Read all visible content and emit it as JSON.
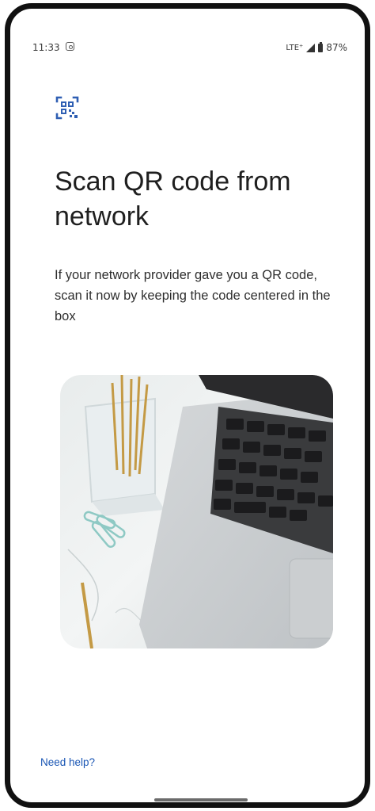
{
  "status_bar": {
    "time": "11:33",
    "network": "LTE⁺",
    "battery": "87%"
  },
  "icons": {
    "header": "qr-code-scan-icon",
    "status": [
      "camera-notification-icon",
      "signal-icon",
      "battery-icon"
    ]
  },
  "page": {
    "title": "Scan QR code from network",
    "description": "If your network provider gave you a QR code, scan it now by keeping the code centered in the box"
  },
  "footer": {
    "help_link": "Need help?"
  },
  "colors": {
    "accent": "#1a56b4",
    "text_primary": "#1f1f1f",
    "background": "#ffffff"
  }
}
